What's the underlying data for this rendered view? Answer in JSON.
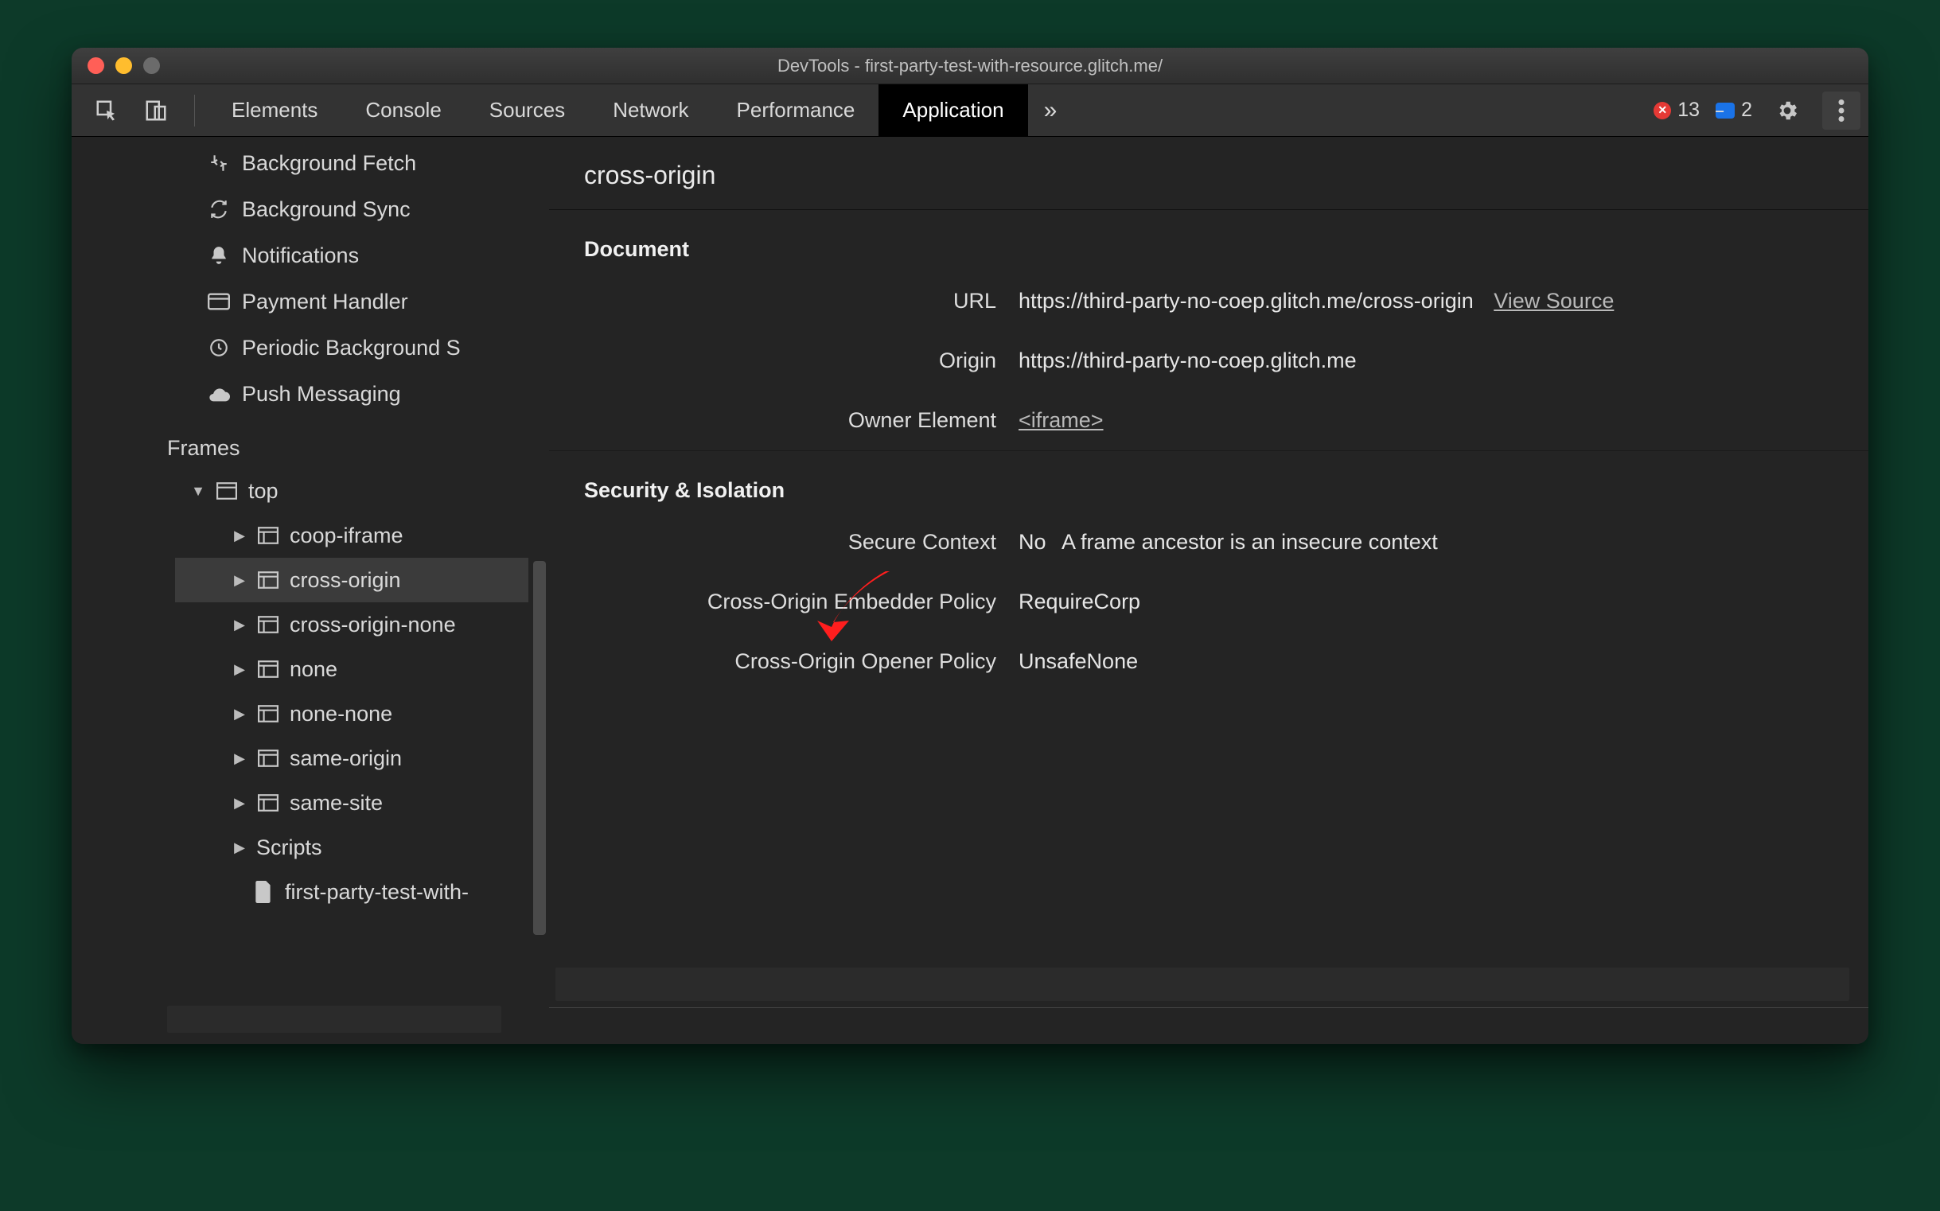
{
  "window": {
    "title": "DevTools - first-party-test-with-resource.glitch.me/"
  },
  "tabs": {
    "items": [
      "Elements",
      "Console",
      "Sources",
      "Network",
      "Performance",
      "Application"
    ],
    "active": "Application"
  },
  "counters": {
    "errors": "13",
    "messages": "2"
  },
  "sidebar": {
    "bg_items": [
      {
        "icon": "fetch",
        "label": "Background Fetch"
      },
      {
        "icon": "sync",
        "label": "Background Sync"
      },
      {
        "icon": "bell",
        "label": "Notifications"
      },
      {
        "icon": "card",
        "label": "Payment Handler"
      },
      {
        "icon": "clock",
        "label": "Periodic Background S"
      },
      {
        "icon": "cloud",
        "label": "Push Messaging"
      }
    ],
    "frames_section": "Frames",
    "tree": {
      "top": "top",
      "items": [
        "coop-iframe",
        "cross-origin",
        "cross-origin-none",
        "none",
        "none-none",
        "same-origin",
        "same-site"
      ],
      "scripts": "Scripts",
      "file": "first-party-test-with-"
    },
    "selected": "cross-origin"
  },
  "main": {
    "title": "cross-origin",
    "document_section": "Document",
    "security_section": "Security & Isolation",
    "rows": {
      "url_label": "URL",
      "url_value": "https://third-party-no-coep.glitch.me/cross-origin",
      "view_source": "View Source",
      "origin_label": "Origin",
      "origin_value": "https://third-party-no-coep.glitch.me",
      "owner_label": "Owner Element",
      "owner_value": "<iframe>",
      "secctx_label": "Secure Context",
      "secctx_value": "No",
      "secctx_extra": "A frame ancestor is an insecure context",
      "coep_label": "Cross-Origin Embedder Policy",
      "coep_value": "RequireCorp",
      "coop_label": "Cross-Origin Opener Policy",
      "coop_value": "UnsafeNone"
    }
  }
}
